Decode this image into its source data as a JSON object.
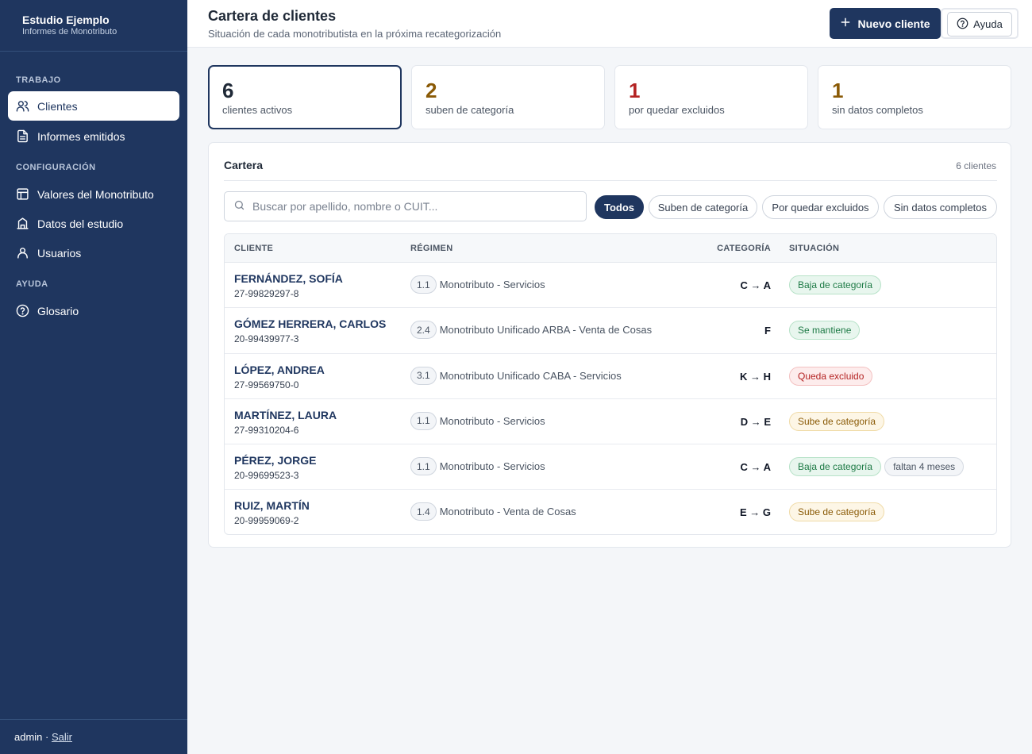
{
  "sidebar": {
    "brand_title": "Estudio Ejemplo",
    "brand_subtitle": "Informes de Monotributo",
    "sections": [
      {
        "label": "TRABAJO"
      },
      {
        "label": "CONFIGURACIÓN"
      },
      {
        "label": "AYUDA"
      }
    ],
    "items": [
      {
        "label": "Clientes",
        "icon": "users-icon",
        "active": true
      },
      {
        "label": "Informes emitidos",
        "icon": "document-icon"
      },
      {
        "label": "Valores del Monotributo",
        "icon": "table-icon"
      },
      {
        "label": "Datos del estudio",
        "icon": "building-icon"
      },
      {
        "label": "Usuarios",
        "icon": "user-icon"
      },
      {
        "label": "Glosario",
        "icon": "help-circle-icon"
      }
    ],
    "footer_user": "admin ·",
    "footer_logout": "Salir"
  },
  "header": {
    "title": "Cartera de clientes",
    "subtitle": "Situación de cada monotributista en la próxima recategorización",
    "new_client_label": "Nuevo cliente",
    "help_label": "Ayuda"
  },
  "stats": [
    {
      "value": "6",
      "label": "clientes activos",
      "color": "#1f2937"
    },
    {
      "value": "2",
      "label": "suben de categoría",
      "color": "#8a5a06"
    },
    {
      "value": "1",
      "label": "por quedar excluidos",
      "color": "#b42323"
    },
    {
      "value": "1",
      "label": "sin datos completos",
      "color": "#8a5a06"
    }
  ],
  "panel": {
    "title": "Cartera",
    "count": "6 clientes",
    "search_placeholder": "Buscar por apellido, nombre o CUIT...",
    "filters": [
      "Todos",
      "Suben de categoría",
      "Por quedar excluidos",
      "Sin datos completos"
    ],
    "columns": [
      "CLIENTE",
      "RÉGIMEN",
      "CATEGORÍA",
      "SITUACIÓN"
    ],
    "rows": [
      {
        "name": "FERNÁNDEZ, SOFÍA",
        "cuit": "27-99829297-8",
        "reg_code": "1.1",
        "reg_name": "Monotributo - Servicios",
        "category": "C → A",
        "status": "Baja de categoría",
        "extra": ""
      },
      {
        "name": "GÓMEZ HERRERA, CARLOS",
        "cuit": "20-99439977-3",
        "reg_code": "2.4",
        "reg_name": "Monotributo Unificado ARBA - Venta de Cosas",
        "category": "F",
        "status": "Se mantiene",
        "extra": ""
      },
      {
        "name": "LÓPEZ, ANDREA",
        "cuit": "27-99569750-0",
        "reg_code": "3.1",
        "reg_name": "Monotributo Unificado CABA - Servicios",
        "category": "K → H",
        "status": "Queda excluido",
        "extra": ""
      },
      {
        "name": "MARTÍNEZ, LAURA",
        "cuit": "27-99310204-6",
        "reg_code": "1.1",
        "reg_name": "Monotributo - Servicios",
        "category": "D → E",
        "status": "Sube de categoría",
        "extra": ""
      },
      {
        "name": "PÉREZ, JORGE",
        "cuit": "20-99699523-3",
        "reg_code": "1.1",
        "reg_name": "Monotributo - Servicios",
        "category": "C → A",
        "status": "Baja de categoría",
        "extra": "faltan 4 meses"
      },
      {
        "name": "RUIZ, MARTÍN",
        "cuit": "20-99959069-2",
        "reg_code": "1.4",
        "reg_name": "Monotributo - Venta de Cosas",
        "category": "E → G",
        "status": "Sube de categoría",
        "extra": ""
      }
    ]
  }
}
